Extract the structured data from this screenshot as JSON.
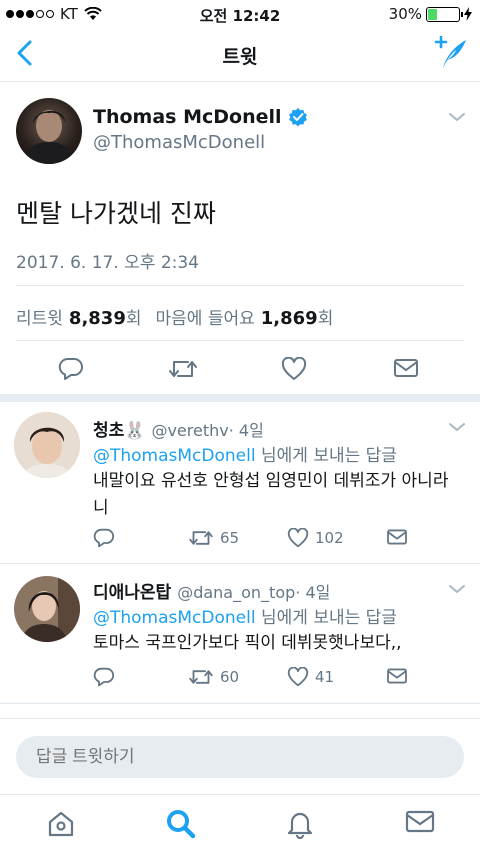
{
  "status_bar": {
    "carrier": "KT",
    "time": "오전 12:42",
    "battery": "30%",
    "battery_level": 0.3
  },
  "nav": {
    "title": "트윗",
    "back_icon": "chevron-left-icon",
    "compose_icon": "compose-tweet-icon"
  },
  "tweet": {
    "name": "Thomas McDonell",
    "handle": "@ThomasMcDonell",
    "text": "멘탈 나가겠네 진짜",
    "timestamp": "2017. 6. 17. 오후 2:34",
    "retweets_label": "리트윗",
    "retweets": "8,839",
    "retweets_unit": "회",
    "likes_label": "마음에 들어요",
    "likes": "1,869",
    "likes_unit": "회"
  },
  "replies": [
    {
      "name": "청초🐰",
      "handle": "@verethv",
      "age": "· 4일",
      "mention": "@ThomasMcDonell",
      "to_suffix": " 님에게 보내는 답글",
      "text": "내말이요 유선호 안형섭 임영민이 데뷔조가 아니라니",
      "retweets": "65",
      "likes": "102"
    },
    {
      "name": "디애나온탑",
      "handle": "@dana_on_top",
      "age": "· 4일",
      "mention": "@ThomasMcDonell",
      "to_suffix": " 님에게 보내는 답글",
      "text": "토마스 국프인가보다 픽이 데뷔못햇나보다,,",
      "retweets": "60",
      "likes": "41"
    }
  ],
  "reply_input": {
    "placeholder": "답글 트윗하기"
  },
  "colors": {
    "accent": "#1da1f2",
    "muted": "#657786",
    "divider": "#e1e8ed",
    "battery": "#4cd964"
  },
  "tabs": [
    "home-icon",
    "search-icon",
    "notifications-icon",
    "messages-icon"
  ]
}
